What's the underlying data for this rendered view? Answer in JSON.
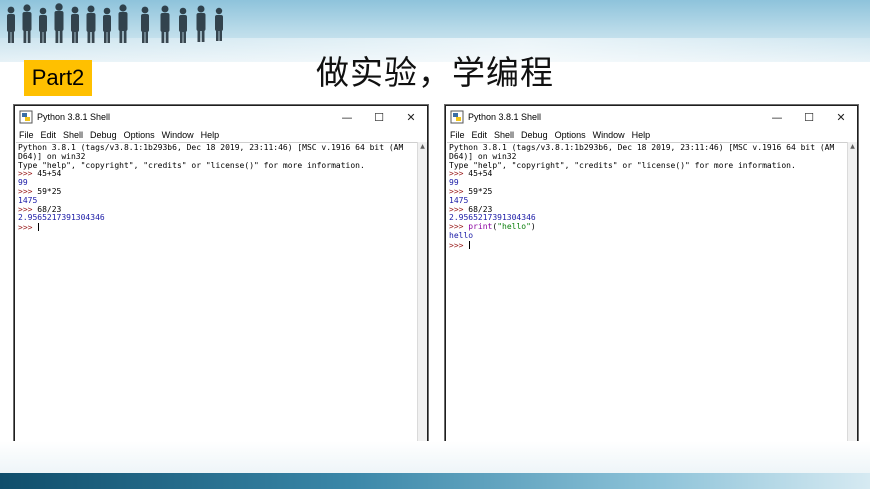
{
  "slide": {
    "badge": "Part2",
    "title": "做实验，学编程",
    "accent_color": "#ffc000"
  },
  "windows": [
    {
      "id": "left",
      "title": "Python 3.8.1 Shell",
      "menu": [
        "File",
        "Edit",
        "Shell",
        "Debug",
        "Options",
        "Window",
        "Help"
      ],
      "controls": {
        "minimize": "—",
        "maximize": "☐",
        "close": "✕"
      },
      "banner": [
        "Python 3.8.1 (tags/v3.8.1:1b293b6, Dec 18 2019, 23:11:46) [MSC v.1916 64 bit (AM",
        "D64)] on win32",
        "Type \"help\", \"copyright\", \"credits\" or \"license()\" for more information."
      ],
      "session": [
        {
          "prompt": ">>> ",
          "input": "45+54",
          "output": "99"
        },
        {
          "prompt": ">>> ",
          "input": "59*25",
          "output": "1475"
        },
        {
          "prompt": ">>> ",
          "input": "68/23",
          "output": "2.9565217391304346"
        }
      ],
      "final_prompt": ">>> "
    },
    {
      "id": "right",
      "title": "Python 3.8.1 Shell",
      "menu": [
        "File",
        "Edit",
        "Shell",
        "Debug",
        "Options",
        "Window",
        "Help"
      ],
      "controls": {
        "minimize": "—",
        "maximize": "☐",
        "close": "✕"
      },
      "banner": [
        "Python 3.8.1 (tags/v3.8.1:1b293b6, Dec 18 2019, 23:11:46) [MSC v.1916 64 bit (AM",
        "D64)] on win32",
        "Type \"help\", \"copyright\", \"credits\" or \"license()\" for more information."
      ],
      "session": [
        {
          "prompt": ">>> ",
          "input": "45+54",
          "output": "99"
        },
        {
          "prompt": ">>> ",
          "input": "59*25",
          "output": "1475"
        },
        {
          "prompt": ">>> ",
          "input": "68/23",
          "output": "2.9565217391304346"
        }
      ],
      "print_call": {
        "prompt": ">>> ",
        "func": "print",
        "open": "(",
        "arg": "\"hello\"",
        "close": ")",
        "output": "hello"
      },
      "final_prompt": ">>> "
    }
  ]
}
